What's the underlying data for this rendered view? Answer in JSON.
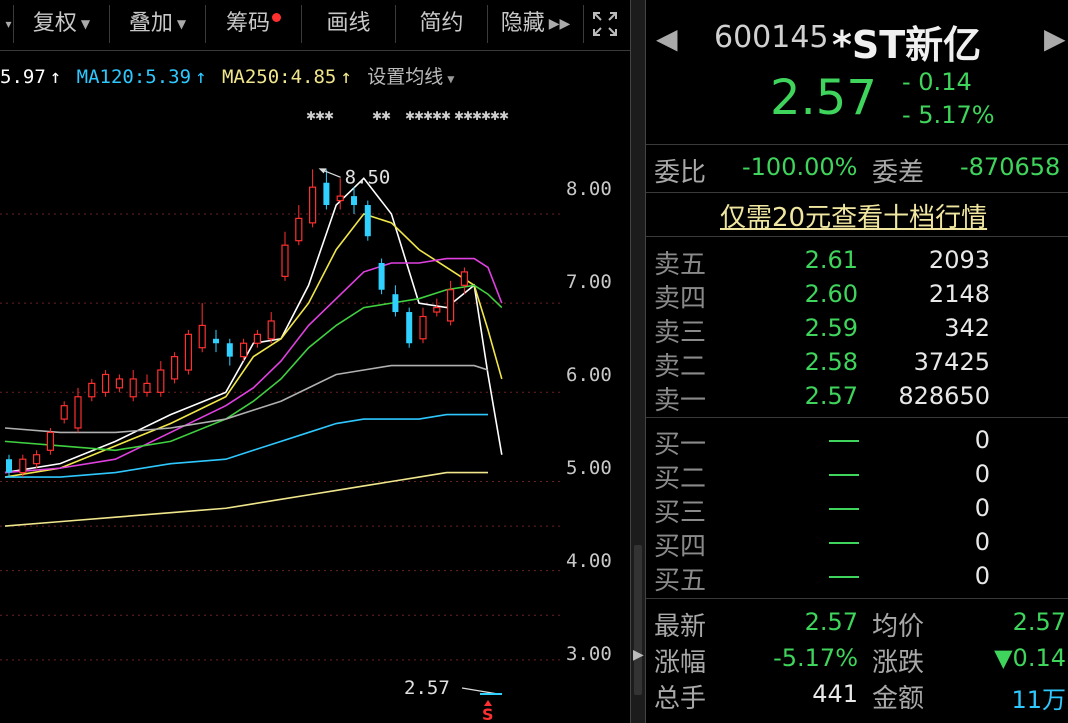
{
  "toolbar": {
    "buttons": [
      "复权",
      "叠加",
      "筹码",
      "画线",
      "简约",
      "隐藏"
    ],
    "expand_icon": "fullscreen-icon"
  },
  "legend": {
    "ma_cut": "5.97",
    "ma120_label": "MA120:5.39",
    "ma250_label": "MA250:4.85",
    "settings_label": "设置均线",
    "colors": {
      "ma_cut": "#ffffff",
      "ma120": "#2ec8ff",
      "ma250": "#f0e68c"
    }
  },
  "chart_annotations": {
    "high_label": "8.50",
    "last_label": "2.57",
    "sell_marker": "S"
  },
  "chart_data": {
    "type": "candlestick",
    "y_ticks": [
      "8.00",
      "7.00",
      "6.00",
      "5.00",
      "4.00",
      "3.00"
    ],
    "ylim": [
      2.55,
      9.3
    ],
    "high_marker": 8.5,
    "last_price": 2.57,
    "candles": [
      {
        "o": 5.25,
        "c": 5.1,
        "h": 5.3,
        "l": 5.05
      },
      {
        "o": 5.1,
        "c": 5.25,
        "h": 5.3,
        "l": 5.05
      },
      {
        "o": 5.2,
        "c": 5.3,
        "h": 5.35,
        "l": 5.15
      },
      {
        "o": 5.35,
        "c": 5.55,
        "h": 5.6,
        "l": 5.3
      },
      {
        "o": 5.7,
        "c": 5.85,
        "h": 5.9,
        "l": 5.65
      },
      {
        "o": 5.6,
        "c": 5.95,
        "h": 6.05,
        "l": 5.55
      },
      {
        "o": 5.95,
        "c": 6.1,
        "h": 6.15,
        "l": 5.9
      },
      {
        "o": 6.0,
        "c": 6.2,
        "h": 6.25,
        "l": 5.95
      },
      {
        "o": 6.05,
        "c": 6.15,
        "h": 6.2,
        "l": 6.0
      },
      {
        "o": 5.95,
        "c": 6.15,
        "h": 6.25,
        "l": 5.9
      },
      {
        "o": 6.0,
        "c": 6.1,
        "h": 6.2,
        "l": 5.95
      },
      {
        "o": 6.0,
        "c": 6.25,
        "h": 6.35,
        "l": 5.95
      },
      {
        "o": 6.15,
        "c": 6.4,
        "h": 6.45,
        "l": 6.1
      },
      {
        "o": 6.25,
        "c": 6.65,
        "h": 6.7,
        "l": 6.2
      },
      {
        "o": 6.5,
        "c": 6.75,
        "h": 7.0,
        "l": 6.45
      },
      {
        "o": 6.6,
        "c": 6.55,
        "h": 6.7,
        "l": 6.45
      },
      {
        "o": 6.55,
        "c": 6.4,
        "h": 6.6,
        "l": 6.3
      },
      {
        "o": 6.4,
        "c": 6.55,
        "h": 6.6,
        "l": 6.35
      },
      {
        "o": 6.55,
        "c": 6.65,
        "h": 6.7,
        "l": 6.5
      },
      {
        "o": 6.6,
        "c": 6.8,
        "h": 6.9,
        "l": 6.55
      },
      {
        "o": 7.3,
        "c": 7.65,
        "h": 7.8,
        "l": 7.25
      },
      {
        "o": 7.7,
        "c": 7.95,
        "h": 8.1,
        "l": 7.65
      },
      {
        "o": 7.9,
        "c": 8.3,
        "h": 8.5,
        "l": 7.85
      },
      {
        "o": 8.35,
        "c": 8.1,
        "h": 8.5,
        "l": 8.05
      },
      {
        "o": 8.15,
        "c": 8.2,
        "h": 8.4,
        "l": 8.05
      },
      {
        "o": 8.2,
        "c": 8.1,
        "h": 8.3,
        "l": 8.0
      },
      {
        "o": 8.1,
        "c": 7.75,
        "h": 8.15,
        "l": 7.7
      },
      {
        "o": 7.45,
        "c": 7.15,
        "h": 7.5,
        "l": 7.1
      },
      {
        "o": 7.1,
        "c": 6.9,
        "h": 7.2,
        "l": 6.85
      },
      {
        "o": 6.9,
        "c": 6.55,
        "h": 6.95,
        "l": 6.5
      },
      {
        "o": 6.6,
        "c": 6.85,
        "h": 6.95,
        "l": 6.55
      },
      {
        "o": 6.9,
        "c": 6.95,
        "h": 7.05,
        "l": 6.85
      },
      {
        "o": 6.8,
        "c": 7.15,
        "h": 7.25,
        "l": 6.75
      },
      {
        "o": 7.2,
        "c": 7.35,
        "h": 7.4,
        "l": 7.1
      }
    ],
    "ma_lines": [
      {
        "name": "MA5",
        "color": "#ffffff",
        "points": [
          [
            0,
            5.1
          ],
          [
            4,
            5.2
          ],
          [
            8,
            5.45
          ],
          [
            12,
            5.75
          ],
          [
            16,
            6.0
          ],
          [
            18,
            6.55
          ],
          [
            20,
            6.6
          ],
          [
            22,
            7.2
          ],
          [
            24,
            8.1
          ],
          [
            26,
            8.4
          ],
          [
            28,
            8.0
          ],
          [
            30,
            7.0
          ],
          [
            32,
            6.95
          ],
          [
            34,
            7.2
          ],
          [
            35,
            6.2
          ],
          [
            36,
            5.3
          ]
        ]
      },
      {
        "name": "MA10",
        "color": "#f0e64a",
        "points": [
          [
            0,
            5.05
          ],
          [
            4,
            5.15
          ],
          [
            8,
            5.4
          ],
          [
            12,
            5.65
          ],
          [
            16,
            5.95
          ],
          [
            18,
            6.4
          ],
          [
            20,
            6.6
          ],
          [
            22,
            7.0
          ],
          [
            24,
            7.6
          ],
          [
            26,
            8.0
          ],
          [
            28,
            7.9
          ],
          [
            30,
            7.6
          ],
          [
            32,
            7.4
          ],
          [
            34,
            7.2
          ],
          [
            35,
            6.7
          ],
          [
            36,
            6.15
          ]
        ]
      },
      {
        "name": "MA20",
        "color": "#e040e0",
        "points": [
          [
            0,
            5.1
          ],
          [
            4,
            5.15
          ],
          [
            8,
            5.25
          ],
          [
            12,
            5.55
          ],
          [
            16,
            5.85
          ],
          [
            18,
            6.05
          ],
          [
            20,
            6.35
          ],
          [
            22,
            6.75
          ],
          [
            24,
            7.05
          ],
          [
            26,
            7.35
          ],
          [
            28,
            7.45
          ],
          [
            30,
            7.45
          ],
          [
            32,
            7.5
          ],
          [
            34,
            7.5
          ],
          [
            35,
            7.4
          ],
          [
            36,
            7.0
          ]
        ]
      },
      {
        "name": "MA30",
        "color": "#40d040",
        "points": [
          [
            0,
            5.45
          ],
          [
            4,
            5.4
          ],
          [
            8,
            5.35
          ],
          [
            12,
            5.45
          ],
          [
            16,
            5.7
          ],
          [
            18,
            5.9
          ],
          [
            20,
            6.15
          ],
          [
            22,
            6.5
          ],
          [
            24,
            6.75
          ],
          [
            26,
            6.95
          ],
          [
            28,
            7.0
          ],
          [
            30,
            7.05
          ],
          [
            32,
            7.15
          ],
          [
            34,
            7.2
          ],
          [
            35,
            7.1
          ],
          [
            36,
            6.95
          ]
        ]
      },
      {
        "name": "MA60",
        "color": "#b0b0b0",
        "points": [
          [
            0,
            5.6
          ],
          [
            4,
            5.55
          ],
          [
            8,
            5.55
          ],
          [
            12,
            5.6
          ],
          [
            16,
            5.7
          ],
          [
            18,
            5.8
          ],
          [
            20,
            5.9
          ],
          [
            22,
            6.05
          ],
          [
            24,
            6.2
          ],
          [
            26,
            6.25
          ],
          [
            28,
            6.3
          ],
          [
            30,
            6.3
          ],
          [
            32,
            6.3
          ],
          [
            34,
            6.3
          ],
          [
            35,
            6.25
          ]
        ]
      },
      {
        "name": "MA120",
        "color": "#2ec8ff",
        "points": [
          [
            0,
            5.05
          ],
          [
            4,
            5.05
          ],
          [
            8,
            5.1
          ],
          [
            12,
            5.2
          ],
          [
            16,
            5.25
          ],
          [
            18,
            5.35
          ],
          [
            20,
            5.45
          ],
          [
            22,
            5.55
          ],
          [
            24,
            5.65
          ],
          [
            26,
            5.7
          ],
          [
            28,
            5.7
          ],
          [
            30,
            5.7
          ],
          [
            32,
            5.75
          ],
          [
            34,
            5.75
          ],
          [
            35,
            5.75
          ]
        ]
      },
      {
        "name": "MA250",
        "color": "#f0e68c",
        "points": [
          [
            0,
            4.5
          ],
          [
            4,
            4.55
          ],
          [
            8,
            4.6
          ],
          [
            12,
            4.65
          ],
          [
            16,
            4.7
          ],
          [
            18,
            4.75
          ],
          [
            20,
            4.8
          ],
          [
            22,
            4.85
          ],
          [
            24,
            4.9
          ],
          [
            26,
            4.95
          ],
          [
            28,
            5.0
          ],
          [
            30,
            5.05
          ],
          [
            32,
            5.1
          ],
          [
            34,
            5.1
          ],
          [
            35,
            5.1
          ]
        ]
      }
    ]
  },
  "quote": {
    "code": "600145",
    "name": "*ST新亿",
    "price": "2.57",
    "change": "- 0.14",
    "change_pct": "- 5.17%",
    "weibi_label": "委比",
    "weibi_value": "-100.00%",
    "weicha_label": "委差",
    "weicha_value": "-870658",
    "promo_link": "仅需20元查看十档行情",
    "up_color": "#ff3030",
    "down_color": "#3fd45c"
  },
  "order_book": {
    "asks": [
      {
        "label": "卖五",
        "price": "2.61",
        "vol": "2093"
      },
      {
        "label": "卖四",
        "price": "2.60",
        "vol": "2148"
      },
      {
        "label": "卖三",
        "price": "2.59",
        "vol": "342"
      },
      {
        "label": "卖二",
        "price": "2.58",
        "vol": "37425"
      },
      {
        "label": "卖一",
        "price": "2.57",
        "vol": "828650"
      }
    ],
    "bids": [
      {
        "label": "买一",
        "vol": "0"
      },
      {
        "label": "买二",
        "vol": "0"
      },
      {
        "label": "买三",
        "vol": "0"
      },
      {
        "label": "买四",
        "vol": "0"
      },
      {
        "label": "买五",
        "vol": "0"
      }
    ]
  },
  "stats": {
    "latest_label": "最新",
    "latest": "2.57",
    "avg_label": "均价",
    "avg": "2.57",
    "range_label": "涨幅",
    "range": "-5.17%",
    "change_label": "涨跌",
    "change": "▼0.14",
    "hands_label": "总手",
    "hands": "441",
    "amount_label": "金额",
    "amount": "11万"
  }
}
